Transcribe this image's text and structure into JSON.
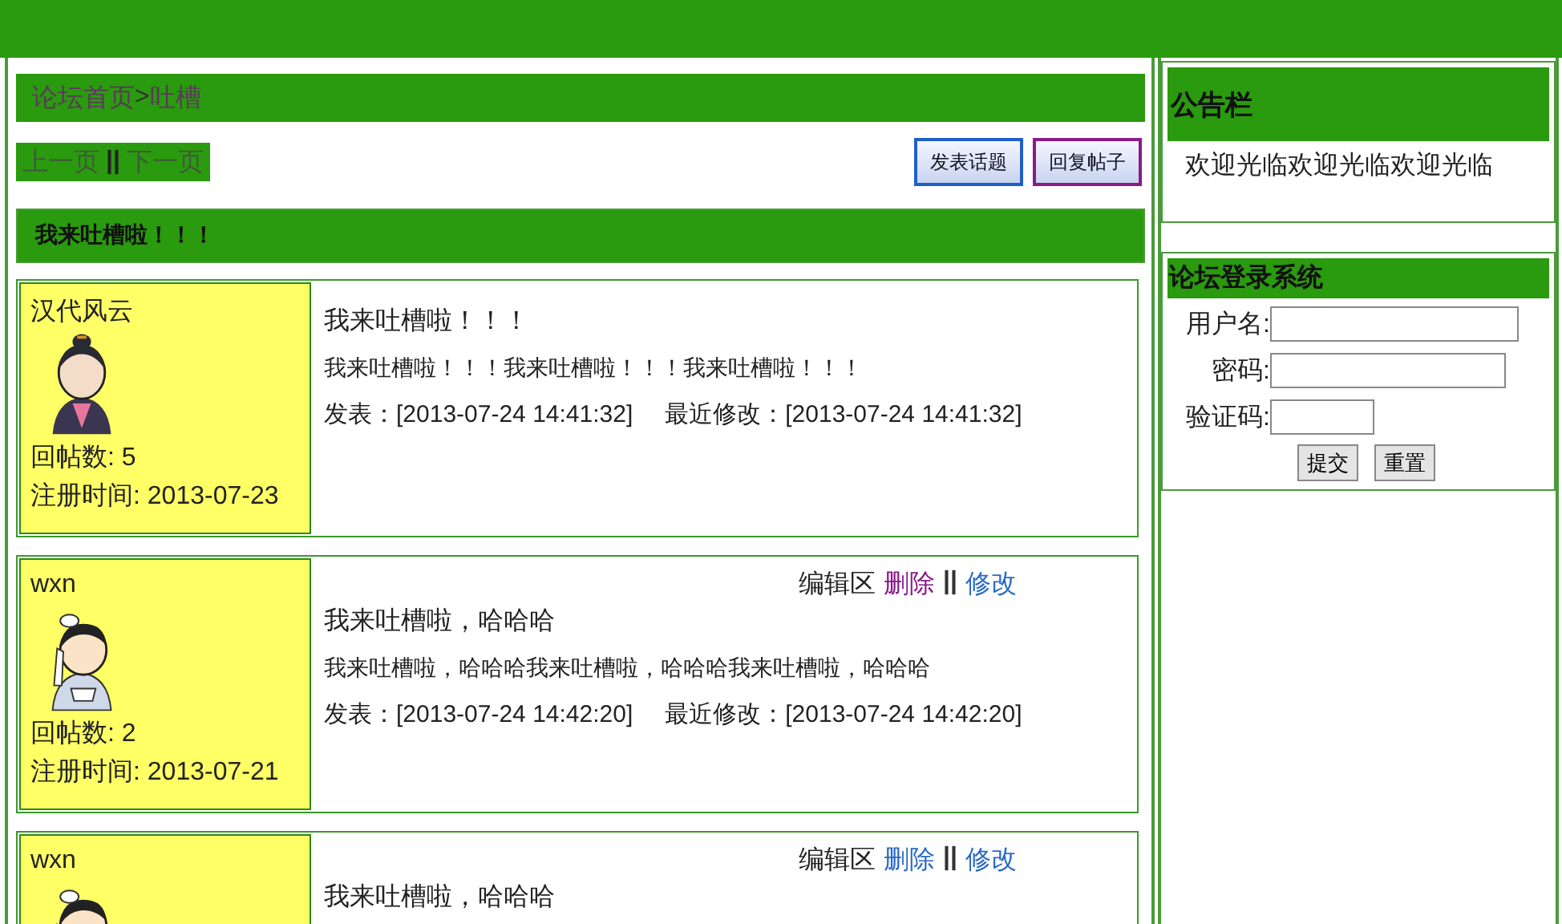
{
  "breadcrumb": [
    {
      "label": "论坛首页",
      "kind": "link"
    },
    {
      "label": ">",
      "kind": "sep"
    },
    {
      "label": "吐槽",
      "kind": "link"
    }
  ],
  "pager": [
    {
      "label": "上一页",
      "kind": "link"
    },
    {
      "label": "||",
      "kind": "sep"
    },
    {
      "label": "下一页",
      "kind": "link"
    }
  ],
  "actions": [
    {
      "label": "发表话题",
      "color": "#1f5fc8"
    },
    {
      "label": "回复帖子",
      "color": "#8a1a8a"
    }
  ],
  "topic_title": "我来吐槽啦！！！",
  "posts": [
    {
      "author": "汉代风云",
      "avatar": {
        "kind": "topknot"
      },
      "replies": "回帖数: 5",
      "registered": "注册时间: 2013-07-23",
      "title": "我来吐槽啦！！！",
      "body": "我来吐槽啦！！！我来吐槽啦！！！我来吐槽啦！！！",
      "posted": "发表：[2013-07-24 14:41:32]",
      "modified": "最近修改：[2013-07-24 14:41:32]"
    },
    {
      "author": "wxn",
      "avatar": {
        "kind": "ribbon"
      },
      "edit": {
        "label": "编辑区",
        "links": [
          {
            "label": "删除",
            "visited": true
          },
          {
            "label": "修改",
            "visited": false
          }
        ],
        "separator": "||"
      },
      "replies": "回帖数: 2",
      "registered": "注册时间: 2013-07-21",
      "title": "我来吐槽啦，哈哈哈",
      "body": "我来吐槽啦，哈哈哈我来吐槽啦，哈哈哈我来吐槽啦，哈哈哈",
      "posted": "发表：[2013-07-24 14:42:20]",
      "modified": "最近修改：[2013-07-24 14:42:20]"
    },
    {
      "author": "wxn",
      "avatar": {
        "kind": "ribbon"
      },
      "edit": {
        "label": "编辑区",
        "links": [
          {
            "label": "删除",
            "visited": false
          },
          {
            "label": "修改",
            "visited": false
          }
        ],
        "separator": "||"
      },
      "title": "我来吐槽啦，哈哈哈"
    }
  ],
  "notice": {
    "title": "公告栏",
    "text": "欢迎光临欢迎光临欢迎光临"
  },
  "login": {
    "title": "论坛登录系统",
    "fields": [
      {
        "label": "用户名:",
        "kind": "long"
      },
      {
        "label": "密码:",
        "kind": "mid"
      },
      {
        "label": "验证码:",
        "kind": "short"
      }
    ],
    "buttons": [
      "提交",
      "重置"
    ]
  }
}
